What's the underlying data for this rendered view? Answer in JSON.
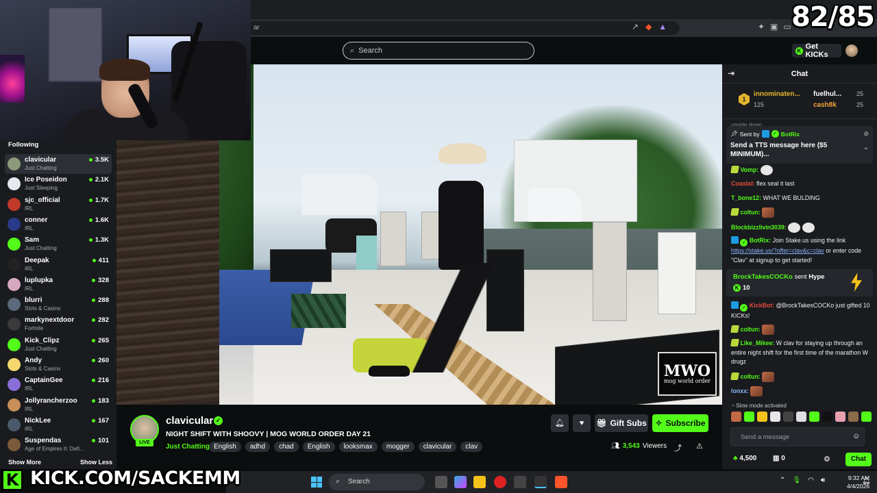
{
  "overlay": {
    "count": "82/85",
    "kick_url": "KICK.COM/SACKEMM",
    "kick_letter": "K"
  },
  "browser": {
    "address": "ar"
  },
  "header": {
    "search_placeholder": "Search",
    "get_kicks": "Get KICKs"
  },
  "sidebar": {
    "title": "Following",
    "channels": [
      {
        "name": "clavicular",
        "category": "Just Chatting",
        "viewers": "3.5K",
        "color": "#8c9a7a"
      },
      {
        "name": "Ice Poseidon",
        "category": "Just Sleeping",
        "viewers": "2.1K",
        "color": "#e8e8f0"
      },
      {
        "name": "sjc_official",
        "category": "IRL",
        "viewers": "1.7K",
        "color": "#c0392b"
      },
      {
        "name": "conner",
        "category": "IRL",
        "viewers": "1.6K",
        "color": "#2a3a8a"
      },
      {
        "name": "Sam",
        "category": "Just Chatting",
        "viewers": "1.3K",
        "color": "#53fc18"
      },
      {
        "name": "Deepak",
        "category": "IRL",
        "viewers": "411",
        "color": "#222"
      },
      {
        "name": "luplupka",
        "category": "IRL",
        "viewers": "328",
        "color": "#d8a8c0"
      },
      {
        "name": "blurri",
        "category": "Slots & Casino",
        "viewers": "288",
        "color": "#5a6a7a"
      },
      {
        "name": "markynextdoor",
        "category": "Fortnite",
        "viewers": "282",
        "color": "#3a3a3a"
      },
      {
        "name": "Kick_Clipz",
        "category": "Just Chatting",
        "viewers": "265",
        "color": "#53fc18"
      },
      {
        "name": "Andy",
        "category": "Slots & Casino",
        "viewers": "260",
        "color": "#f5d76e"
      },
      {
        "name": "CaptainGee",
        "category": "IRL",
        "viewers": "216",
        "color": "#8a6fd8"
      },
      {
        "name": "Jollyrancherzoo",
        "category": "IRL",
        "viewers": "183",
        "color": "#c98f5a"
      },
      {
        "name": "NickLee",
        "category": "IRL",
        "viewers": "167",
        "color": "#4a5a6a"
      },
      {
        "name": "Suspendas",
        "category": "Age of Empires II: Defi...",
        "viewers": "101",
        "color": "#7a5a3a"
      }
    ],
    "show_more": "Show More",
    "show_less": "Show Less"
  },
  "video": {
    "watermark": "MWO",
    "watermark_sub": "mog world order"
  },
  "stream": {
    "name": "clavicular",
    "live": "LIVE",
    "title": "NIGHT SHIFT WITH SHOOVY | MOG WORLD ORDER DAY 21",
    "category": "Just Chatting",
    "tags": [
      "English",
      "adhd",
      "chad",
      "English",
      "looksmax",
      "mogger",
      "clavicular",
      "clav"
    ],
    "gift_subs": "Gift Subs",
    "subscribe": "Subscribe",
    "viewers": "3,543",
    "viewers_label": "Viewers"
  },
  "chat": {
    "title": "Chat",
    "leaderboard": {
      "rank": "1",
      "first": {
        "name": "innominaten...",
        "value": "125",
        "color": "#e3b52d"
      },
      "second": {
        "name": "fuelhul...",
        "value": "25",
        "color": "#ffffff"
      },
      "third": {
        "name": "cash8k",
        "value": "25",
        "color": "#f4a236"
      }
    },
    "partial_text": "upside down",
    "pinned": {
      "sent_by": "Sent by",
      "sender": "BotRix",
      "text": "Send a TTS message here ($5 MINIMUM)..."
    },
    "messages": [
      {
        "user": "Vomp:",
        "color": "#53fc18",
        "text": ""
      },
      {
        "user": "Coastal:",
        "color": "#e74c3c",
        "text": "flex seal it last"
      },
      {
        "user": "T_bone12:",
        "color": "#53fc18",
        "text": "WHAT WE BULDING"
      },
      {
        "user": "coltun:",
        "color": "#53fc18",
        "text": ""
      },
      {
        "user": "Blockbizzlivin3039:",
        "color": "#53fc18",
        "text": ""
      },
      {
        "user": "BotRix:",
        "color": "#53fc18",
        "text": "Join Stake.us using the link",
        "link": "https://stake.us/?offer=clav&c=clav",
        "text2": "or enter code \"Clav\" at signup to get started!"
      },
      {
        "user": "KickBot:",
        "color": "#e74c3c",
        "text": "@BrockTakesCOCKo just gifted 10 KICKs!"
      },
      {
        "user": "coltun:",
        "color": "#53fc18",
        "text": ""
      },
      {
        "user": "Like_Mikee:",
        "color": "#53fc18",
        "text": "W clav for staying up through an entire night shift for the first time of the marathon W drugz"
      },
      {
        "user": "coltun:",
        "color": "#53fc18",
        "text": ""
      },
      {
        "user": "lonxx:",
        "color": "#8ab4f8",
        "text": ""
      }
    ],
    "hype": {
      "user": "BrockTakesCOCKo",
      "sent": "sent",
      "item": "Hype",
      "amount": "10"
    },
    "slow_mode": "Slow mode activated",
    "input_placeholder": "Send a message",
    "kicks_balance": "4,500",
    "cup_count": "0",
    "send_label": "Chat"
  },
  "taskbar": {
    "search": "Search",
    "time": "9:32 AM",
    "date": "4/4/2026"
  }
}
